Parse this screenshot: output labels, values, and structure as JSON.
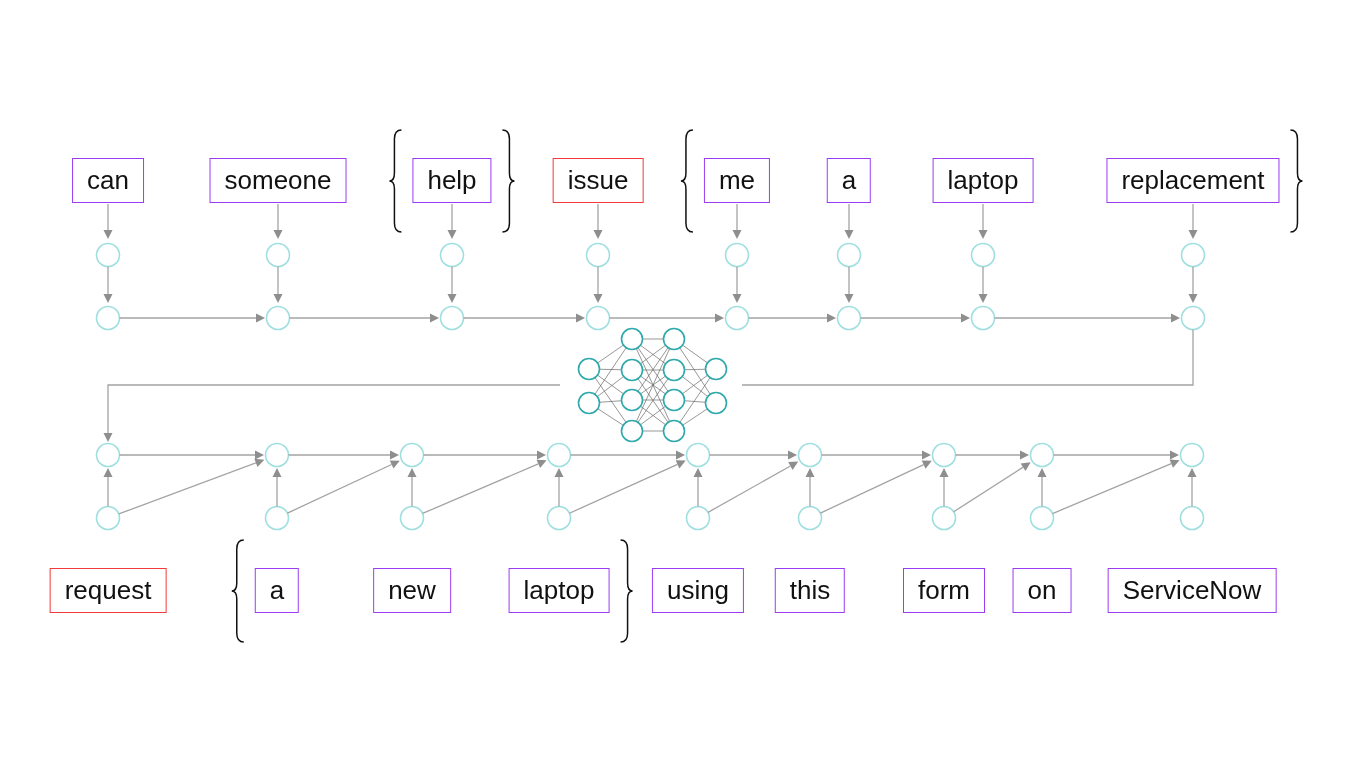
{
  "encoder_sentence": [
    {
      "kind": "word",
      "text": "can",
      "color": "#9b3cf2"
    },
    {
      "kind": "word",
      "text": "someone",
      "color": "#9b3cf2"
    },
    {
      "kind": "group",
      "children": [
        {
          "kind": "word",
          "text": "help",
          "color": "#9b3cf2"
        }
      ]
    },
    {
      "kind": "word",
      "text": "issue",
      "color": "#f23a3a"
    },
    {
      "kind": "group",
      "children": [
        {
          "kind": "word",
          "text": "me",
          "color": "#9b3cf2"
        },
        {
          "kind": "word",
          "text": "a",
          "color": "#9b3cf2"
        },
        {
          "kind": "word",
          "text": "laptop",
          "color": "#9b3cf2"
        },
        {
          "kind": "word",
          "text": "replacement",
          "color": "#9b3cf2"
        }
      ]
    }
  ],
  "decoder_sentence": [
    {
      "kind": "word",
      "text": "request",
      "color": "#f23a3a"
    },
    {
      "kind": "group",
      "children": [
        {
          "kind": "word",
          "text": "a",
          "color": "#9b3cf2"
        },
        {
          "kind": "word",
          "text": "new",
          "color": "#9b3cf2"
        },
        {
          "kind": "word",
          "text": "laptop",
          "color": "#9b3cf2"
        }
      ]
    },
    {
      "kind": "word",
      "text": "using",
      "color": "#9b3cf2"
    },
    {
      "kind": "word",
      "text": "this",
      "color": "#9b3cf2"
    },
    {
      "kind": "word",
      "text": "form",
      "color": "#9b3cf2"
    },
    {
      "kind": "word",
      "text": "on",
      "color": "#9b3cf2"
    },
    {
      "kind": "word",
      "text": "ServiceNow",
      "color": "#9b3cf2"
    }
  ]
}
